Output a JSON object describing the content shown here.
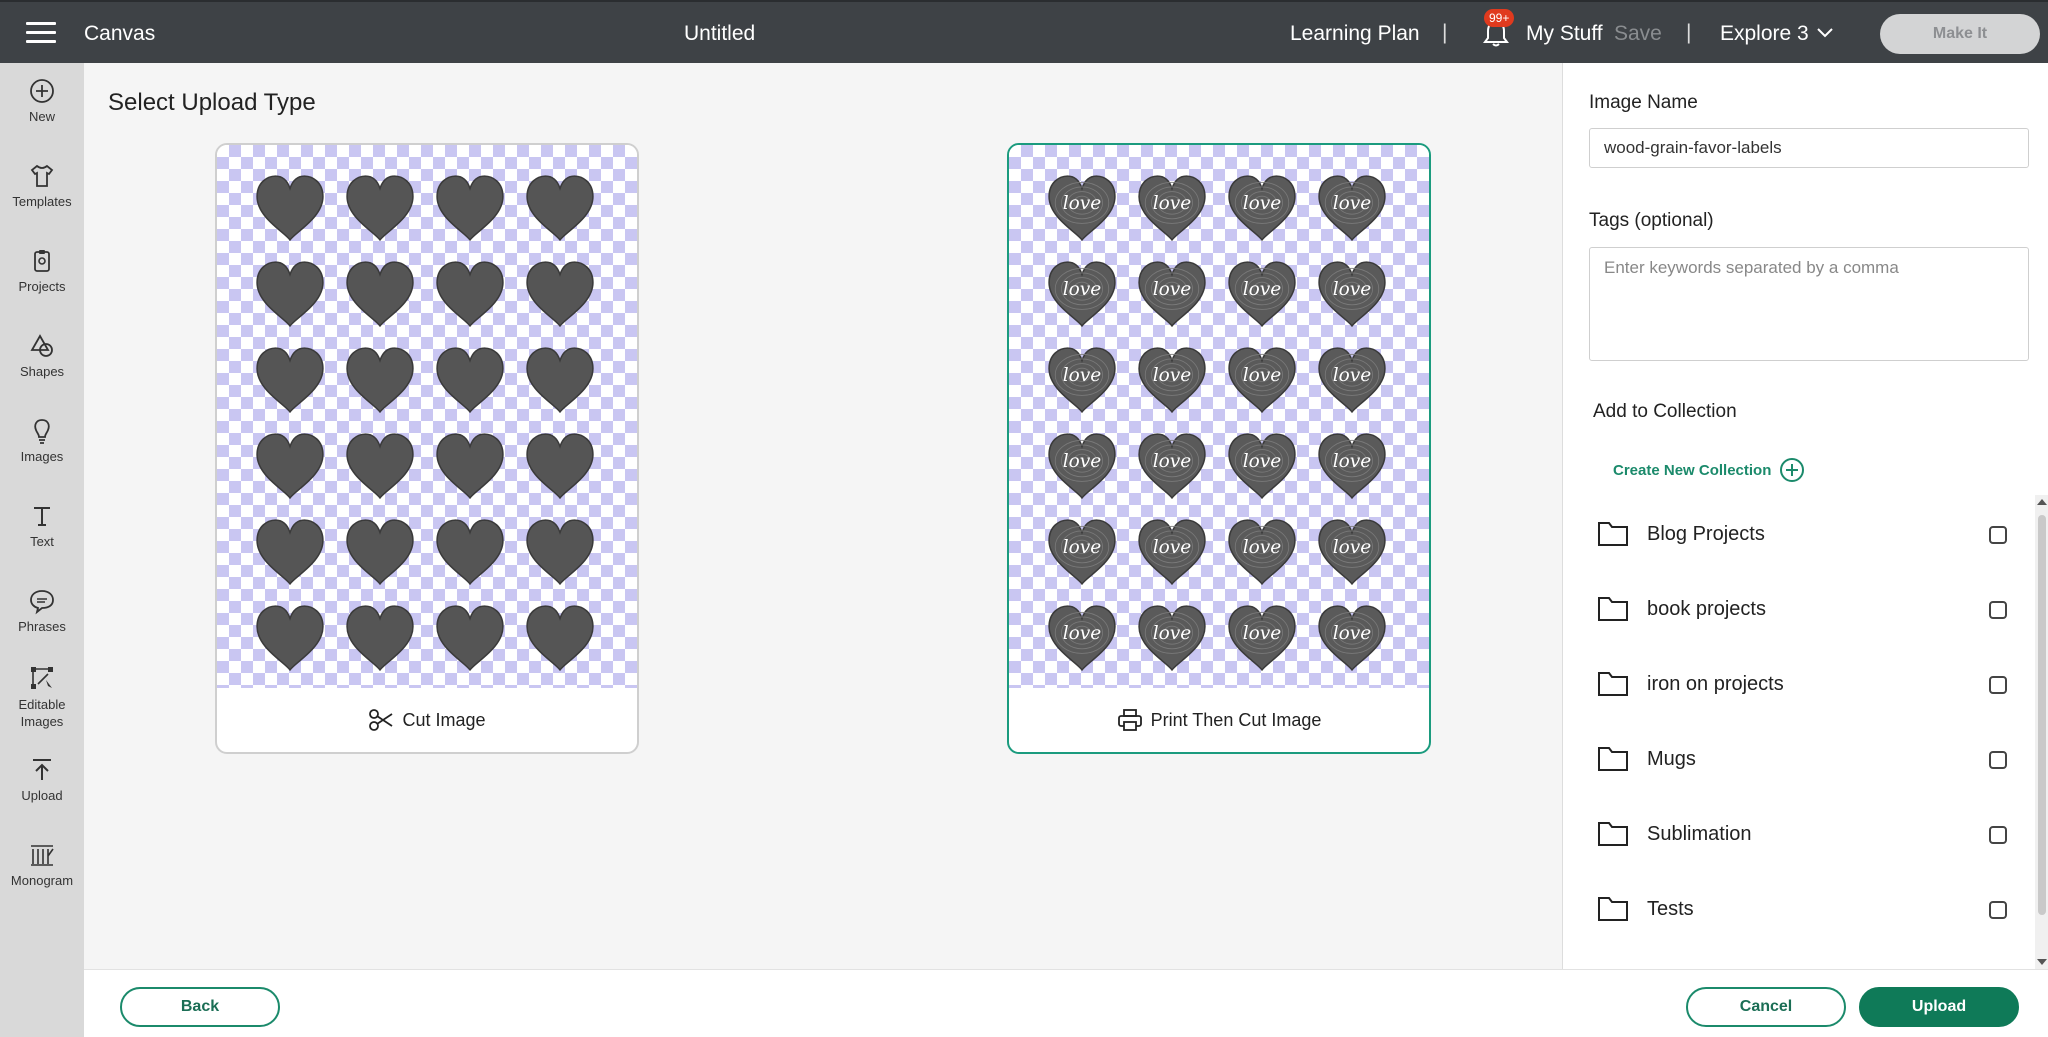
{
  "topbar": {
    "app_title": "Canvas",
    "doc_title": "Untitled",
    "learning_plan": "Learning Plan",
    "separator": "|",
    "notification_badge": "99+",
    "my_stuff": "My Stuff",
    "save": "Save",
    "machine": "Explore 3",
    "make_it": "Make It"
  },
  "sidebar": {
    "items": [
      {
        "label": "New",
        "icon": "plus-circle-icon"
      },
      {
        "label": "Templates",
        "icon": "shirt-icon"
      },
      {
        "label": "Projects",
        "icon": "clipboard-icon"
      },
      {
        "label": "Shapes",
        "icon": "shapes-icon"
      },
      {
        "label": "Images",
        "icon": "bulb-icon"
      },
      {
        "label": "Text",
        "icon": "text-t-icon"
      },
      {
        "label": "Phrases",
        "icon": "speech-bubble-icon"
      },
      {
        "label": "Editable Images",
        "icon": "vector-edit-icon"
      },
      {
        "label": "Upload",
        "icon": "upload-arrow-icon"
      },
      {
        "label": "Monogram",
        "icon": "monogram-icon"
      }
    ]
  },
  "main": {
    "title": "Select Upload Type",
    "cut_card": {
      "label": "Cut Image",
      "icon": "scissors-icon",
      "selected": false
    },
    "print_card": {
      "label": "Print Then Cut Image",
      "icon": "printer-icon",
      "selected": true,
      "heart_text": "love"
    }
  },
  "panel": {
    "image_name_label": "Image Name",
    "image_name_value": "wood-grain-favor-labels",
    "tags_label": "Tags (optional)",
    "tags_placeholder": "Enter keywords separated by a comma",
    "collection_label": "Add to Collection",
    "create_new": "Create New Collection",
    "collections": [
      "Blog Projects",
      "book projects",
      "iron on projects",
      "Mugs",
      "Sublimation",
      "Tests"
    ]
  },
  "footer": {
    "back": "Back",
    "cancel": "Cancel",
    "upload": "Upload"
  },
  "colors": {
    "accent": "#1b8a6b",
    "topbar": "#3e4246",
    "checker": "#c9c6f2",
    "heart": "#555555"
  }
}
